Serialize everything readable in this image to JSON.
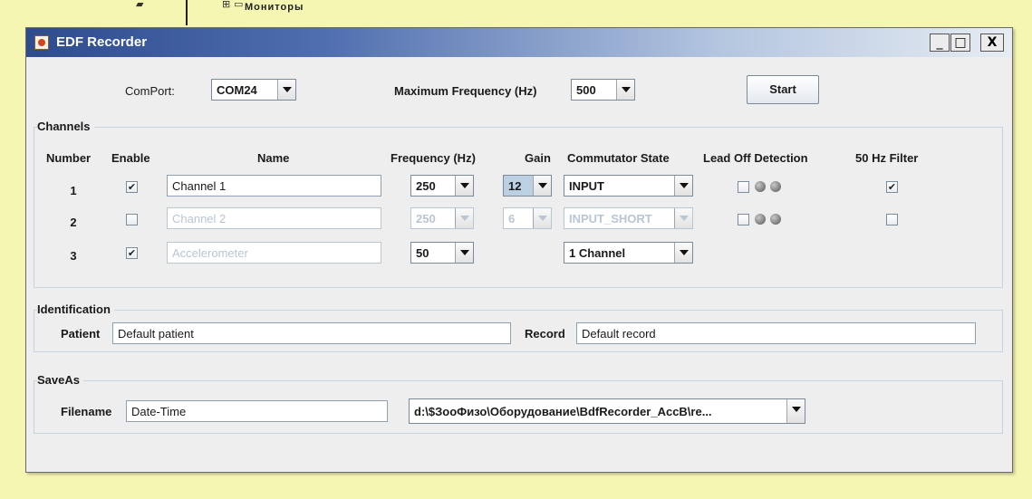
{
  "background": {
    "tree_text": "Мониторы"
  },
  "window": {
    "title": "EDF Recorder",
    "controls": {
      "minimize": "_",
      "maximize": "□",
      "close": "X"
    }
  },
  "top": {
    "comport_label": "ComPort:",
    "comport_value": "COM24",
    "maxfreq_label": "Maximum Frequency (Hz)",
    "maxfreq_value": "500",
    "start_label": "Start"
  },
  "channels": {
    "group_title": "Channels",
    "headers": {
      "number": "Number",
      "enable": "Enable",
      "name": "Name",
      "frequency": "Frequency (Hz)",
      "gain": "Gain",
      "commutator": "Commutator State",
      "leadoff": "Lead Off Detection",
      "filter": "50 Hz Filter"
    },
    "rows": [
      {
        "number": "1",
        "enabled": "✔",
        "name": "Channel 1",
        "frequency": "250",
        "gain": "12",
        "commutator": "INPUT",
        "leadoff_checked": "",
        "filter_checked": "✔"
      },
      {
        "number": "2",
        "enabled": "",
        "name": "Channel 2",
        "frequency": "250",
        "gain": "6",
        "commutator": "INPUT_SHORT",
        "leadoff_checked": "",
        "filter_checked": ""
      },
      {
        "number": "3",
        "enabled": "✔",
        "name": "Accelerometer",
        "frequency": "50",
        "commutator": "1 Channel"
      }
    ]
  },
  "identification": {
    "group_title": "Identification",
    "patient_label": "Patient",
    "patient_value": "Default patient",
    "record_label": "Record",
    "record_value": "Default record"
  },
  "saveas": {
    "group_title": "SaveAs",
    "filename_label": "Filename",
    "filename_value": "Date-Time",
    "directory_value": "d:\\$ЗооФизо\\Оборудование\\BdfRecorder_AccB\\re..."
  }
}
